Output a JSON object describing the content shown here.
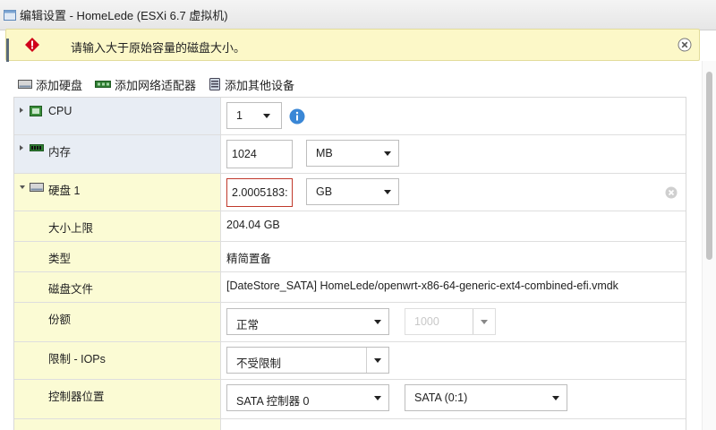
{
  "window": {
    "title": "编辑设置 - HomeLede (ESXi 6.7 虚拟机)"
  },
  "banner": {
    "message": "请输入大于原始容量的磁盘大小。"
  },
  "toolbar": {
    "add_disk": "添加硬盘",
    "add_network": "添加网络适配器",
    "add_other": "添加其他设备"
  },
  "cpu": {
    "label": "CPU",
    "value": "1"
  },
  "memory": {
    "label": "内存",
    "value": "1024",
    "unit": "MB"
  },
  "disk": {
    "label": "硬盘 1",
    "value": "2.0005183:",
    "unit": "GB",
    "max_size_label": "大小上限",
    "max_size_value": "204.04 GB",
    "type_label": "类型",
    "type_value": "精简置备",
    "file_label": "磁盘文件",
    "file_value": "[DateStore_SATA] HomeLede/openwrt-x86-64-generic-ext4-combined-efi.vmdk",
    "shares_label": "份额",
    "shares_value": "正常",
    "shares_number": "1000",
    "limit_label": "限制 - IOPs",
    "limit_value": "不受限制",
    "controller_label": "控制器位置",
    "controller_value": "SATA 控制器 0",
    "controller_port": "SATA (0:1)"
  },
  "colors": {
    "label_bg": "#e8edf4",
    "selected_bg": "#fbfbd4",
    "banner_bg": "#fcf8c8",
    "error_border": "#c0392b",
    "info_blue": "#3a87d6"
  }
}
